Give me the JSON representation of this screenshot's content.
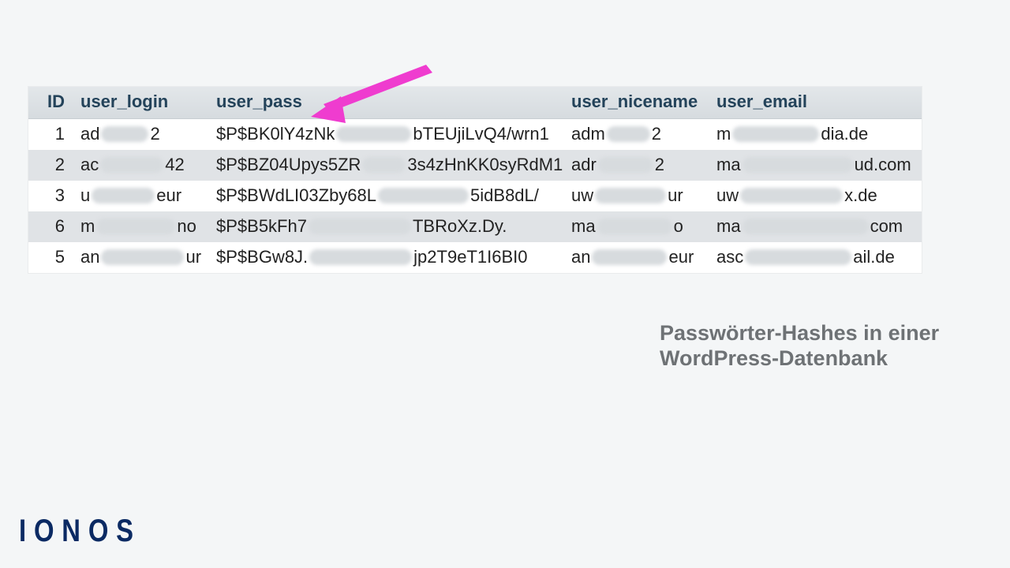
{
  "table": {
    "columns": [
      "ID",
      "user_login",
      "user_pass",
      "user_nicename",
      "user_email"
    ],
    "rows": [
      {
        "id": "1",
        "login_pre": "ad",
        "login_blur": 60,
        "login_post": "2",
        "pass_pre": "$P$BK0lY4zNk",
        "pass_blur": 95,
        "pass_post": "bTEUjiLvQ4/wrn1",
        "nice_pre": "adm",
        "nice_blur": 55,
        "nice_post": "2",
        "email_pre": "m",
        "email_blur": 110,
        "email_post": "dia.de"
      },
      {
        "id": "2",
        "login_pre": "ac",
        "login_blur": 80,
        "login_post": "42",
        "pass_pre": "$P$BZ04Upys5ZR",
        "pass_blur": 55,
        "pass_post": "3s4zHnKK0syRdM1",
        "nice_pre": "adr",
        "nice_blur": 70,
        "nice_post": "2",
        "email_pre": "ma",
        "email_blur": 140,
        "email_post": "ud.com"
      },
      {
        "id": "3",
        "login_pre": "u",
        "login_blur": 80,
        "login_post": "eur",
        "pass_pre": "$P$BWdLI03Zby68L",
        "pass_blur": 115,
        "pass_post": "5idB8dL/",
        "nice_pre": "uw",
        "nice_blur": 90,
        "nice_post": "ur",
        "email_pre": "uw",
        "email_blur": 130,
        "email_post": "x.de"
      },
      {
        "id": "6",
        "login_pre": "m",
        "login_blur": 100,
        "login_post": "no",
        "pass_pre": "$P$B5kFh7",
        "pass_blur": 130,
        "pass_post": "TBRoXz.Dy.",
        "nice_pre": "ma",
        "nice_blur": 95,
        "nice_post": "o",
        "email_pre": "ma",
        "email_blur": 160,
        "email_post": "com"
      },
      {
        "id": "5",
        "login_pre": "an",
        "login_blur": 105,
        "login_post": "ur",
        "pass_pre": "$P$BGw8J.",
        "pass_blur": 130,
        "pass_post": "jp2T9eT1I6BI0",
        "nice_pre": "an",
        "nice_blur": 95,
        "nice_post": "eur",
        "email_pre": "asc",
        "email_blur": 135,
        "email_post": "ail.de"
      }
    ]
  },
  "caption": "Passwörter-Hashes in einer WordPress-Datenbank",
  "logo_text": "IONOS",
  "arrow_color": "#ef3ccf"
}
